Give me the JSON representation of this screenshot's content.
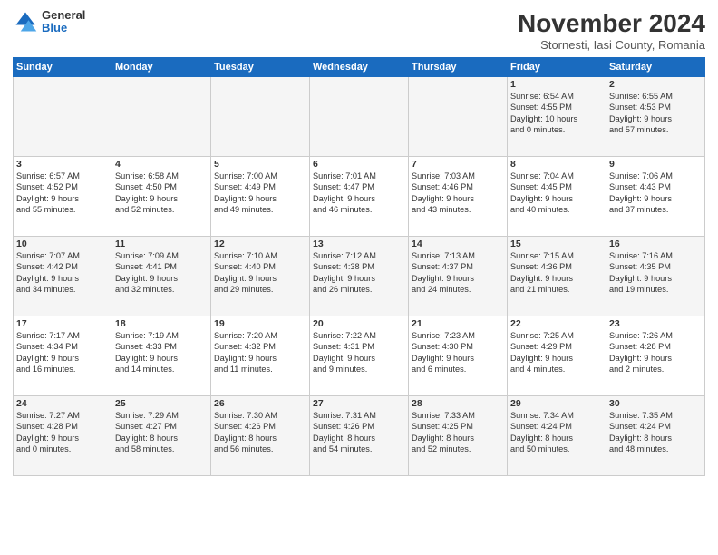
{
  "header": {
    "logo_general": "General",
    "logo_blue": "Blue",
    "title": "November 2024",
    "subtitle": "Stornesti, Iasi County, Romania"
  },
  "weekdays": [
    "Sunday",
    "Monday",
    "Tuesday",
    "Wednesday",
    "Thursday",
    "Friday",
    "Saturday"
  ],
  "weeks": [
    [
      {
        "day": "",
        "info": ""
      },
      {
        "day": "",
        "info": ""
      },
      {
        "day": "",
        "info": ""
      },
      {
        "day": "",
        "info": ""
      },
      {
        "day": "",
        "info": ""
      },
      {
        "day": "1",
        "info": "Sunrise: 6:54 AM\nSunset: 4:55 PM\nDaylight: 10 hours\nand 0 minutes."
      },
      {
        "day": "2",
        "info": "Sunrise: 6:55 AM\nSunset: 4:53 PM\nDaylight: 9 hours\nand 57 minutes."
      }
    ],
    [
      {
        "day": "3",
        "info": "Sunrise: 6:57 AM\nSunset: 4:52 PM\nDaylight: 9 hours\nand 55 minutes."
      },
      {
        "day": "4",
        "info": "Sunrise: 6:58 AM\nSunset: 4:50 PM\nDaylight: 9 hours\nand 52 minutes."
      },
      {
        "day": "5",
        "info": "Sunrise: 7:00 AM\nSunset: 4:49 PM\nDaylight: 9 hours\nand 49 minutes."
      },
      {
        "day": "6",
        "info": "Sunrise: 7:01 AM\nSunset: 4:47 PM\nDaylight: 9 hours\nand 46 minutes."
      },
      {
        "day": "7",
        "info": "Sunrise: 7:03 AM\nSunset: 4:46 PM\nDaylight: 9 hours\nand 43 minutes."
      },
      {
        "day": "8",
        "info": "Sunrise: 7:04 AM\nSunset: 4:45 PM\nDaylight: 9 hours\nand 40 minutes."
      },
      {
        "day": "9",
        "info": "Sunrise: 7:06 AM\nSunset: 4:43 PM\nDaylight: 9 hours\nand 37 minutes."
      }
    ],
    [
      {
        "day": "10",
        "info": "Sunrise: 7:07 AM\nSunset: 4:42 PM\nDaylight: 9 hours\nand 34 minutes."
      },
      {
        "day": "11",
        "info": "Sunrise: 7:09 AM\nSunset: 4:41 PM\nDaylight: 9 hours\nand 32 minutes."
      },
      {
        "day": "12",
        "info": "Sunrise: 7:10 AM\nSunset: 4:40 PM\nDaylight: 9 hours\nand 29 minutes."
      },
      {
        "day": "13",
        "info": "Sunrise: 7:12 AM\nSunset: 4:38 PM\nDaylight: 9 hours\nand 26 minutes."
      },
      {
        "day": "14",
        "info": "Sunrise: 7:13 AM\nSunset: 4:37 PM\nDaylight: 9 hours\nand 24 minutes."
      },
      {
        "day": "15",
        "info": "Sunrise: 7:15 AM\nSunset: 4:36 PM\nDaylight: 9 hours\nand 21 minutes."
      },
      {
        "day": "16",
        "info": "Sunrise: 7:16 AM\nSunset: 4:35 PM\nDaylight: 9 hours\nand 19 minutes."
      }
    ],
    [
      {
        "day": "17",
        "info": "Sunrise: 7:17 AM\nSunset: 4:34 PM\nDaylight: 9 hours\nand 16 minutes."
      },
      {
        "day": "18",
        "info": "Sunrise: 7:19 AM\nSunset: 4:33 PM\nDaylight: 9 hours\nand 14 minutes."
      },
      {
        "day": "19",
        "info": "Sunrise: 7:20 AM\nSunset: 4:32 PM\nDaylight: 9 hours\nand 11 minutes."
      },
      {
        "day": "20",
        "info": "Sunrise: 7:22 AM\nSunset: 4:31 PM\nDaylight: 9 hours\nand 9 minutes."
      },
      {
        "day": "21",
        "info": "Sunrise: 7:23 AM\nSunset: 4:30 PM\nDaylight: 9 hours\nand 6 minutes."
      },
      {
        "day": "22",
        "info": "Sunrise: 7:25 AM\nSunset: 4:29 PM\nDaylight: 9 hours\nand 4 minutes."
      },
      {
        "day": "23",
        "info": "Sunrise: 7:26 AM\nSunset: 4:28 PM\nDaylight: 9 hours\nand 2 minutes."
      }
    ],
    [
      {
        "day": "24",
        "info": "Sunrise: 7:27 AM\nSunset: 4:28 PM\nDaylight: 9 hours\nand 0 minutes."
      },
      {
        "day": "25",
        "info": "Sunrise: 7:29 AM\nSunset: 4:27 PM\nDaylight: 8 hours\nand 58 minutes."
      },
      {
        "day": "26",
        "info": "Sunrise: 7:30 AM\nSunset: 4:26 PM\nDaylight: 8 hours\nand 56 minutes."
      },
      {
        "day": "27",
        "info": "Sunrise: 7:31 AM\nSunset: 4:26 PM\nDaylight: 8 hours\nand 54 minutes."
      },
      {
        "day": "28",
        "info": "Sunrise: 7:33 AM\nSunset: 4:25 PM\nDaylight: 8 hours\nand 52 minutes."
      },
      {
        "day": "29",
        "info": "Sunrise: 7:34 AM\nSunset: 4:24 PM\nDaylight: 8 hours\nand 50 minutes."
      },
      {
        "day": "30",
        "info": "Sunrise: 7:35 AM\nSunset: 4:24 PM\nDaylight: 8 hours\nand 48 minutes."
      }
    ]
  ]
}
